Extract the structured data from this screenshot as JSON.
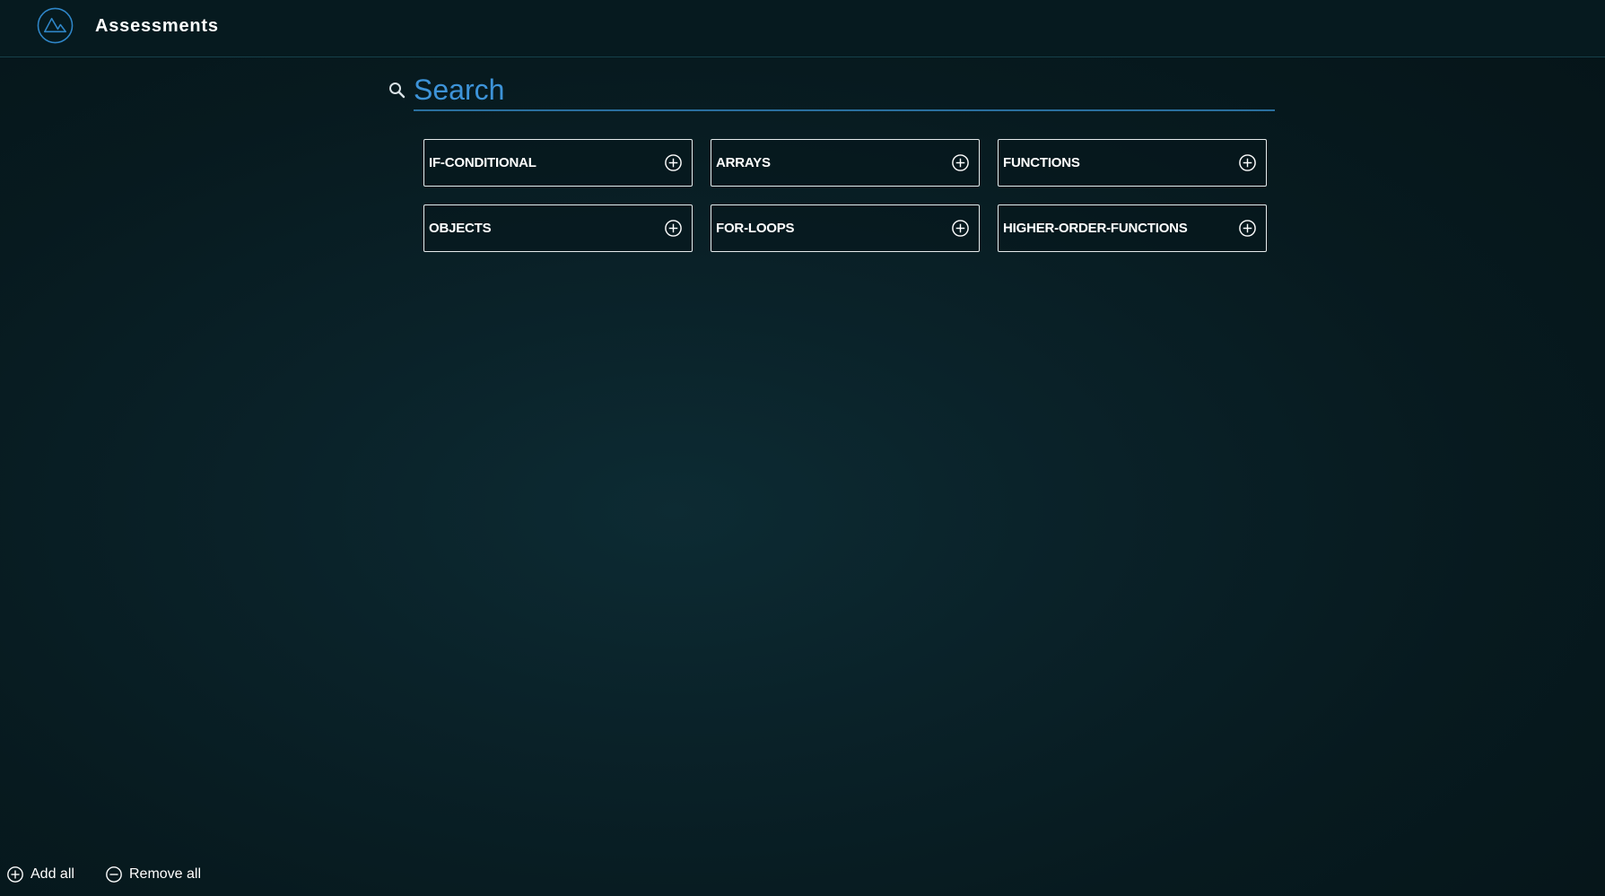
{
  "header": {
    "title": "Assessments",
    "logo_icon": "mountain-logo-icon"
  },
  "search": {
    "placeholder": "Search",
    "value": "",
    "icon": "search-icon"
  },
  "topics": [
    {
      "label": "IF-CONDITIONAL",
      "icon": "plus-circle-icon"
    },
    {
      "label": "ARRAYS",
      "icon": "plus-circle-icon"
    },
    {
      "label": "FUNCTIONS",
      "icon": "plus-circle-icon"
    },
    {
      "label": "OBJECTS",
      "icon": "plus-circle-icon"
    },
    {
      "label": "FOR-LOOPS",
      "icon": "plus-circle-icon"
    },
    {
      "label": "HIGHER-ORDER-FUNCTIONS",
      "icon": "plus-circle-icon"
    }
  ],
  "footer": {
    "add_all_label": "Add all",
    "remove_all_label": "Remove all"
  },
  "colors": {
    "background": "#071a1f",
    "topbar": "#061a1f",
    "accent": "#3d93d8",
    "card_border": "#e6ebec"
  }
}
